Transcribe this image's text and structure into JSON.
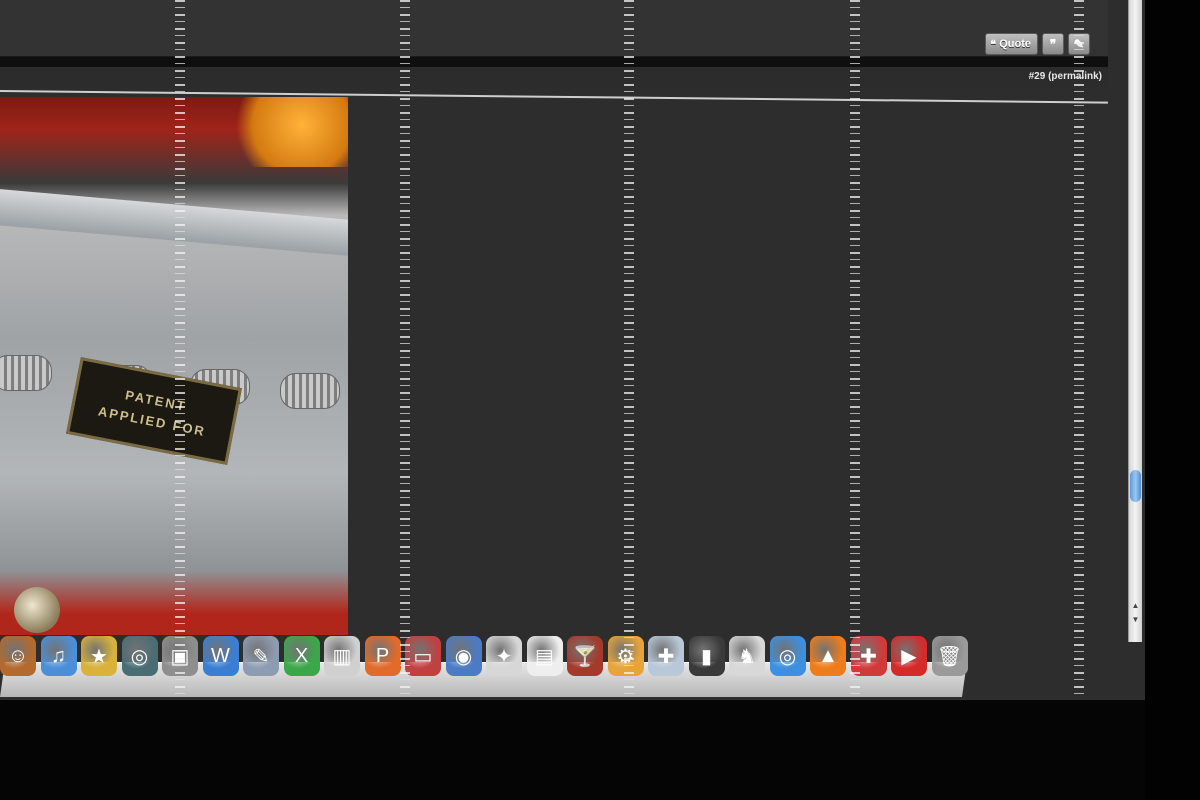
{
  "post": {
    "actions": {
      "quote_label": "Quote",
      "quote_icon": "quote-icon",
      "multiquote_icon": "multi-quote-icon",
      "edit_icon": "edit-icon"
    },
    "permalink": "#29 (permalink)"
  },
  "image": {
    "plate_line1": "PATENT",
    "plate_line2": "APPLIED FOR"
  },
  "dock": {
    "items": [
      {
        "name": "finder",
        "icon": "finder-icon",
        "color": "#b26a2e",
        "glyph": "☺"
      },
      {
        "name": "itunes",
        "icon": "itunes-icon",
        "color": "#4b8fd8",
        "glyph": "♫"
      },
      {
        "name": "imovie",
        "icon": "star-icon",
        "color": "#d8b23a",
        "glyph": "★"
      },
      {
        "name": "dvd-player",
        "icon": "dvd-icon",
        "color": "#4a6d74",
        "glyph": "◎"
      },
      {
        "name": "photo-booth",
        "icon": "camera-icon",
        "color": "#8e8e8e",
        "glyph": "▣"
      },
      {
        "name": "word",
        "icon": "word-icon",
        "color": "#3a7ed4",
        "glyph": "W"
      },
      {
        "name": "preview",
        "icon": "pen-icon",
        "color": "#8e9cb3",
        "glyph": "✎"
      },
      {
        "name": "excel",
        "icon": "excel-icon",
        "color": "#3aa84a",
        "glyph": "X"
      },
      {
        "name": "keynote",
        "icon": "chart-icon",
        "color": "#d0d0d0",
        "glyph": "▥"
      },
      {
        "name": "powerpoint",
        "icon": "powerpoint-icon",
        "color": "#e26a2a",
        "glyph": "P"
      },
      {
        "name": "presentation",
        "icon": "podium-icon",
        "color": "#c14040",
        "glyph": "▭"
      },
      {
        "name": "dvd-studio",
        "icon": "disc-icon",
        "color": "#4a7bc4",
        "glyph": "◉"
      },
      {
        "name": "safari",
        "icon": "compass-icon",
        "color": "#d7d7d7",
        "glyph": "✦"
      },
      {
        "name": "text-edit",
        "icon": "document-icon",
        "color": "#eeeeee",
        "glyph": "▤"
      },
      {
        "name": "cocktail",
        "icon": "cocktail-icon",
        "color": "#a33a2a",
        "glyph": "🍸"
      },
      {
        "name": "automator",
        "icon": "robot-icon",
        "color": "#e7a43a",
        "glyph": "⚙"
      },
      {
        "name": "disk-utility",
        "icon": "drive-icon",
        "color": "#b8c8d8",
        "glyph": "✚"
      },
      {
        "name": "terminal",
        "icon": "terminal-icon",
        "color": "#3a3a3a",
        "glyph": "▮"
      },
      {
        "name": "horse",
        "icon": "horse-icon",
        "color": "#d8d8d8",
        "glyph": "♞"
      },
      {
        "name": "iphoto",
        "icon": "aperture-icon",
        "color": "#3d8fe0",
        "glyph": "◎"
      },
      {
        "name": "vlc",
        "icon": "cone-icon",
        "color": "#ef7c1a",
        "glyph": "▲"
      },
      {
        "name": "utility",
        "icon": "tools-icon",
        "color": "#d23a3a",
        "glyph": "✚"
      },
      {
        "name": "youtube",
        "icon": "youtube-icon",
        "color": "#d42a2a",
        "glyph": "▶"
      },
      {
        "name": "trash",
        "icon": "trash-icon",
        "color": "#9a9a9a",
        "glyph": "🗑"
      }
    ]
  },
  "colors": {
    "forum_bg": "#2d2d2d",
    "scroll_thumb": "#5d9ad8"
  }
}
